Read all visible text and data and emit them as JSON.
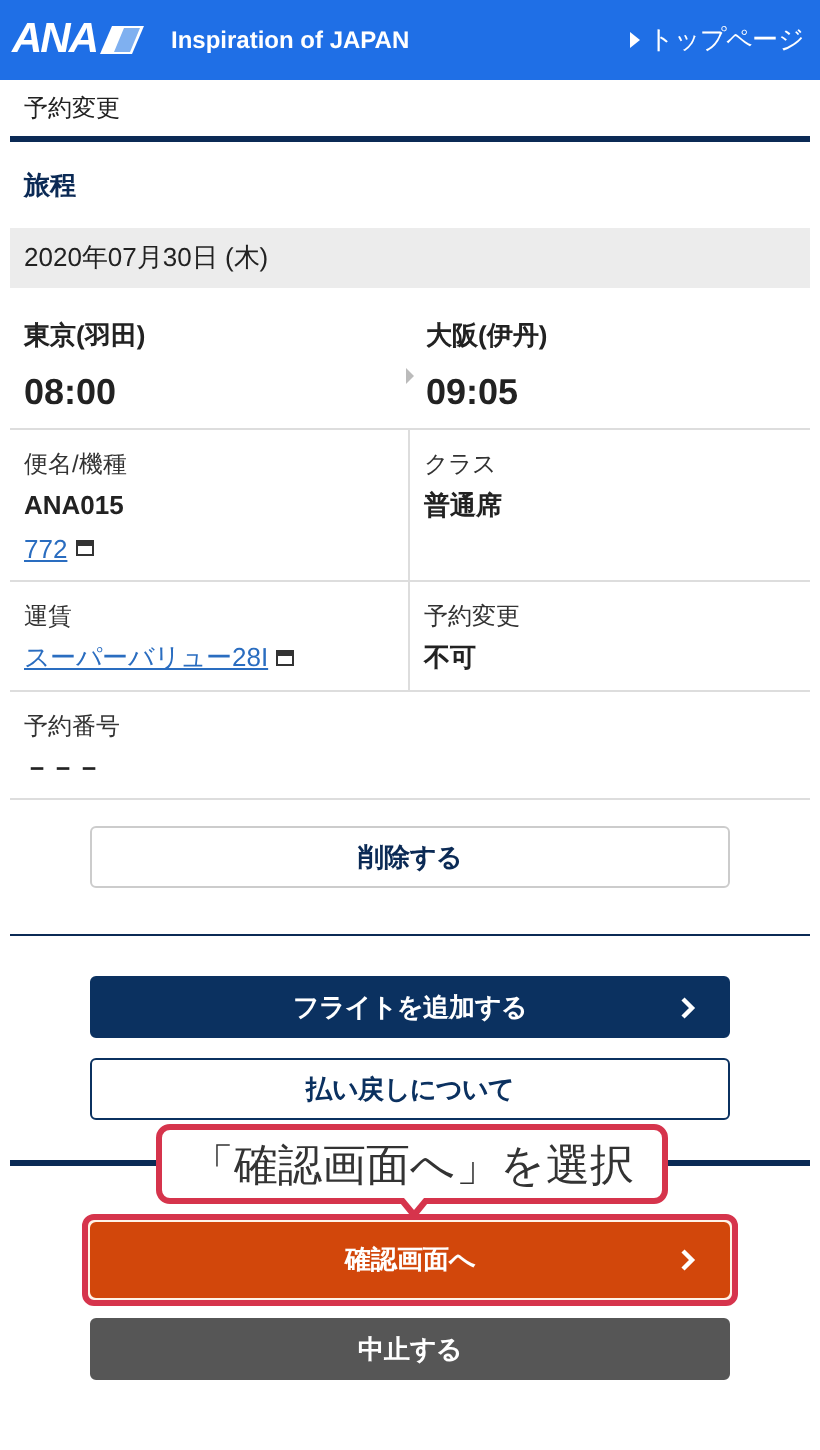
{
  "header": {
    "logo": "ANA",
    "tagline": "Inspiration of JAPAN",
    "top_link": "トップページ"
  },
  "breadcrumb": "予約変更",
  "section_title": "旅程",
  "date": "2020年07月30日 (木)",
  "departure": {
    "city": "東京(羽田)",
    "time": "08:00"
  },
  "arrival": {
    "city": "大阪(伊丹)",
    "time": "09:05"
  },
  "detail_rows": [
    {
      "cells": [
        {
          "label": "便名/機種",
          "lines": [
            {
              "kind": "text",
              "text": "ANA015"
            },
            {
              "kind": "link",
              "text": "772"
            }
          ]
        },
        {
          "label": "クラス",
          "lines": [
            {
              "kind": "text",
              "text": "普通席"
            }
          ]
        }
      ]
    },
    {
      "cells": [
        {
          "label": "運賃",
          "lines": [
            {
              "kind": "link",
              "text": "スーパーバリュー28I"
            }
          ]
        },
        {
          "label": "予約変更",
          "lines": [
            {
              "kind": "text",
              "text": "不可"
            }
          ]
        }
      ]
    },
    {
      "cells": [
        {
          "label": "予約番号",
          "lines": [
            {
              "kind": "text",
              "text": "－－－"
            }
          ]
        }
      ]
    }
  ],
  "delete_button": "削除する",
  "actions": [
    {
      "kind": "navy",
      "label": "フライトを追加する",
      "chevron": true
    },
    {
      "kind": "outline",
      "label": "払い戻しについて",
      "chevron": false
    }
  ],
  "final_actions": [
    {
      "kind": "orange",
      "label": "確認画面へ",
      "chevron": true,
      "highlighted": true
    },
    {
      "kind": "dark",
      "label": "中止する",
      "chevron": false,
      "highlighted": false
    }
  ],
  "callout": "「確認画面へ」を選択"
}
